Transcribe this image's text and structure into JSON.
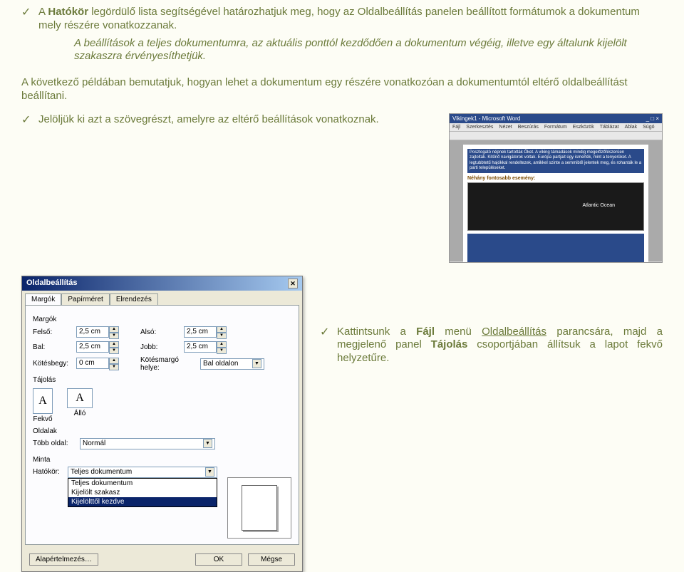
{
  "bullets": {
    "b1_pre": "A ",
    "b1_bold": "Hatókör",
    "b1_post": " legördülő lista segítségével határozhatjuk meg, hogy az Oldalbeállítás panelen beállított formátumok a dokumentum mely részére vonatkozzanak.",
    "b2": "A beállítások a teljes dokumentumra, az aktuális ponttól kezdődően a dokumentum végéig, illetve egy általunk kijelölt szakaszra érvényesíthetjük.",
    "mid_para": "A következő példában bemutatjuk, hogyan lehet a dokumentum egy részére vonatkozóan a dokumentumtól eltérő oldalbeállítást beállítani.",
    "b3": "Jelöljük ki azt a szövegrészt, amelyre az eltérő beállítások vonatkoznak.",
    "b4a": "Kattintsunk a ",
    "b4b": "Fájl",
    "b4c": " menü ",
    "b4d": "Oldalbeállítás",
    "b4e": " parancsára, majd a megjelenő panel ",
    "b4f": "Tájolás",
    "b4g": " csoportjában állítsuk a lapot fekvő helyzetűre."
  },
  "word_app": {
    "title": "Vikingek1 - Microsoft Word",
    "menus": [
      "Fájl",
      "Szerkesztés",
      "Nézet",
      "Beszúrás",
      "Formátum",
      "Eszközök",
      "Táblázat",
      "Ablak",
      "Súgó"
    ],
    "heading": "Néhány fontosabb esemény:",
    "selected_text": "Posztogató népnek tartották Őket.\nA viking támadások mindig megelőzőfészerüen zajtolták. Kitűnő navigátorok voltak. Európa partjait úgy ismerték, mint a tenyerüket. A legtubbtetű hajókkal rendeltezek, amikkel szinte a semmiből jelentek meg, és rohanták le a parti településeket.",
    "map_label": "Atlantic\nOcean"
  },
  "dialog": {
    "title": "Oldalbeállítás",
    "tabs": [
      "Margók",
      "Papírméret",
      "Elrendezés"
    ],
    "group_margins": "Margók",
    "felso_lbl": "Felső:",
    "felso_val": "2,5 cm",
    "also_lbl": "Alsó:",
    "also_val": "2,5 cm",
    "bal_lbl": "Bal:",
    "bal_val": "2,5 cm",
    "jobb_lbl": "Jobb:",
    "jobb_val": "2,5 cm",
    "koteshegy_lbl": "Kötésbegy:",
    "koteshegy_val": "0 cm",
    "kotesmargo_lbl": "Kötésmargó helye:",
    "kotesmargo_val": "Bal oldalon",
    "group_tajolas": "Tájolás",
    "fekvo": "Fekvő",
    "allo": "Álló",
    "group_oldalak": "Oldalak",
    "tobb_oldal_lbl": "Több oldal:",
    "tobb_oldal_val": "Normál",
    "group_minta": "Minta",
    "hatokor_lbl": "Hatókör:",
    "hatokor_val": "Teljes dokumentum",
    "dropdown": [
      "Teljes dokumentum",
      "Kijelölt szakasz",
      "Kijelölttől kezdve"
    ],
    "btn_default": "Alapértelmezés…",
    "btn_ok": "OK",
    "btn_cancel": "Mégse"
  }
}
